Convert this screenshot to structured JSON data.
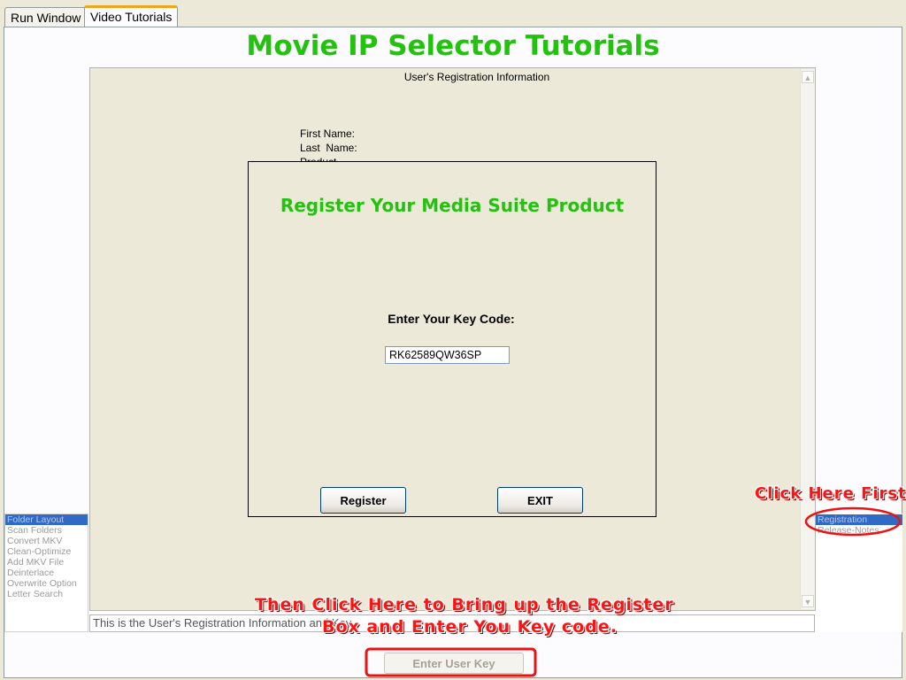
{
  "tabs": [
    {
      "label": "Run Window",
      "active": false
    },
    {
      "label": "Video Tutorials",
      "active": true
    }
  ],
  "page_title": "Movie IP Selector Tutorials",
  "doc": {
    "heading": "User's Registration Information",
    "fields": [
      "First Name:",
      "Last  Name:",
      "Product"
    ],
    "status_text": "This is the User's Registration Information and Key"
  },
  "left_list": {
    "items": [
      "Folder Layout",
      "Scan Folders",
      "Convert MKV",
      "Clean-Optimize",
      "Add MKV File",
      "Deinterlace",
      "Overwrite Option",
      "Letter Search"
    ],
    "selected_index": 0
  },
  "right_list": {
    "items": [
      "Registration",
      "Release-Notes"
    ],
    "selected_index": 0
  },
  "dialog": {
    "title": "Register Your Media Suite Product",
    "key_label": "Enter Your Key Code:",
    "key_value": "RK62589QW36SP",
    "register_label": "Register",
    "exit_label": "EXIT"
  },
  "enter_key_label": "Enter User Key",
  "annotations": {
    "click_first": "Click Here First",
    "then_line1": "Then Click Here to Bring up the Register",
    "then_line2": "Box and Enter You Key code."
  },
  "colors": {
    "title_green": "#22c20e",
    "annotation_red": "#ff1212",
    "selection_blue": "#316ac5",
    "tab_accent": "#f1a31a"
  }
}
